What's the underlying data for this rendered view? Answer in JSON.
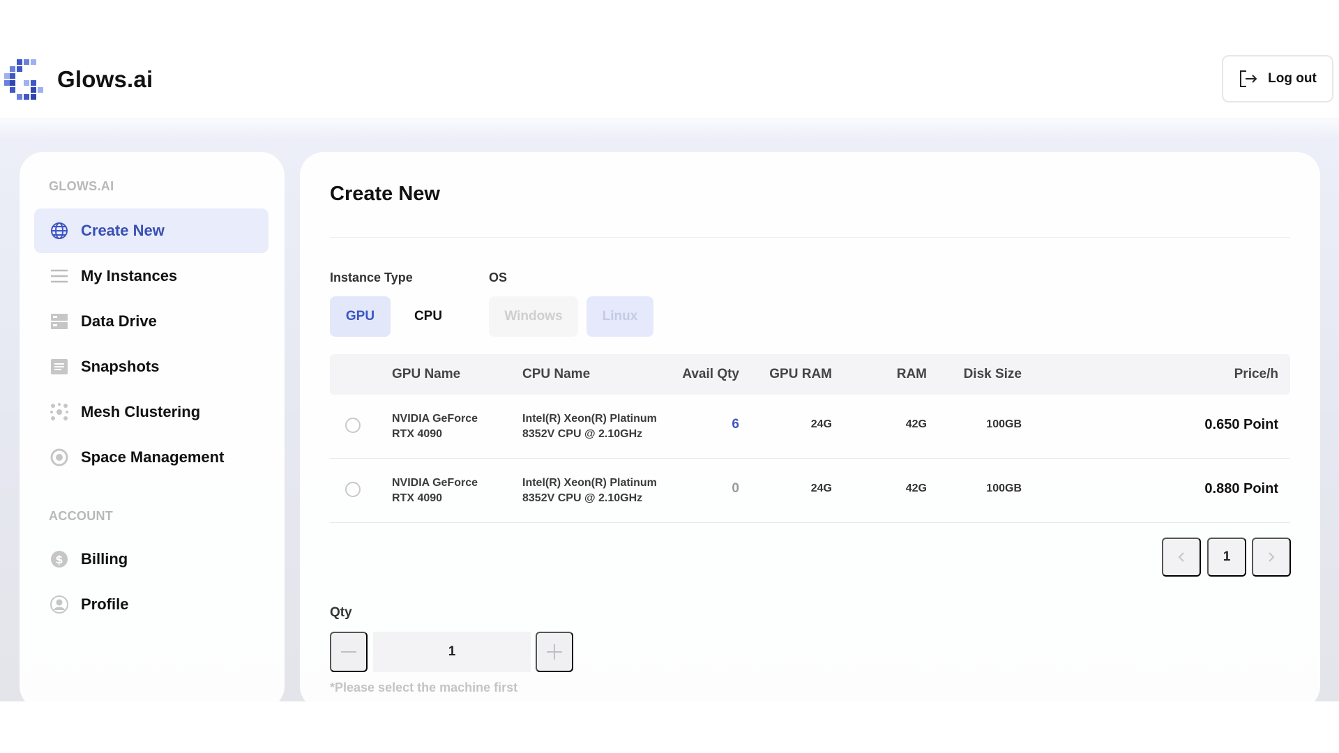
{
  "header": {
    "brand_name": "Glows.ai",
    "logout_label": "Log out"
  },
  "sidebar": {
    "section_main": "GLOWS.AI",
    "items": [
      {
        "label": "Create New",
        "icon": "globe-icon",
        "active": true
      },
      {
        "label": "My Instances",
        "icon": "list-icon"
      },
      {
        "label": "Data Drive",
        "icon": "drive-icon"
      },
      {
        "label": "Snapshots",
        "icon": "snapshot-icon"
      },
      {
        "label": "Mesh Clustering",
        "icon": "cluster-icon"
      },
      {
        "label": "Space Management",
        "icon": "space-icon"
      }
    ],
    "section_account": "ACCOUNT",
    "account_items": [
      {
        "label": "Billing",
        "icon": "dollar-icon"
      },
      {
        "label": "Profile",
        "icon": "user-icon"
      }
    ]
  },
  "main": {
    "title": "Create New",
    "instance_type_label": "Instance Type",
    "os_label": "OS",
    "instance_types": [
      "GPU",
      "CPU"
    ],
    "os_options": [
      "Windows",
      "Linux"
    ],
    "table": {
      "columns": [
        "GPU Name",
        "CPU Name",
        "Avail Qty",
        "GPU RAM",
        "RAM",
        "Disk Size",
        "Price/h"
      ],
      "rows": [
        {
          "gpu_line1": "NVIDIA GeForce",
          "gpu_line2": "RTX 4090",
          "cpu_line1": "Intel(R) Xeon(R) Platinum",
          "cpu_line2": "8352V CPU @ 2.10GHz",
          "avail": "6",
          "gpu_ram": "24G",
          "ram": "42G",
          "disk": "100GB",
          "price": "0.650 Point"
        },
        {
          "gpu_line1": "NVIDIA GeForce",
          "gpu_line2": "RTX 4090",
          "cpu_line1": "Intel(R) Xeon(R) Platinum",
          "cpu_line2": "8352V CPU @ 2.10GHz",
          "avail": "0",
          "gpu_ram": "24G",
          "ram": "42G",
          "disk": "100GB",
          "price": "0.880 Point"
        }
      ]
    },
    "pagination": {
      "current_page": "1"
    },
    "qty_label": "Qty",
    "qty_value": "1",
    "hint": "*Please select the machine first"
  },
  "colors": {
    "accent": "#3c54c2",
    "active_bg": "#e8ecfb",
    "avail_positive": "#3c54c2",
    "avail_zero": "#999999"
  }
}
